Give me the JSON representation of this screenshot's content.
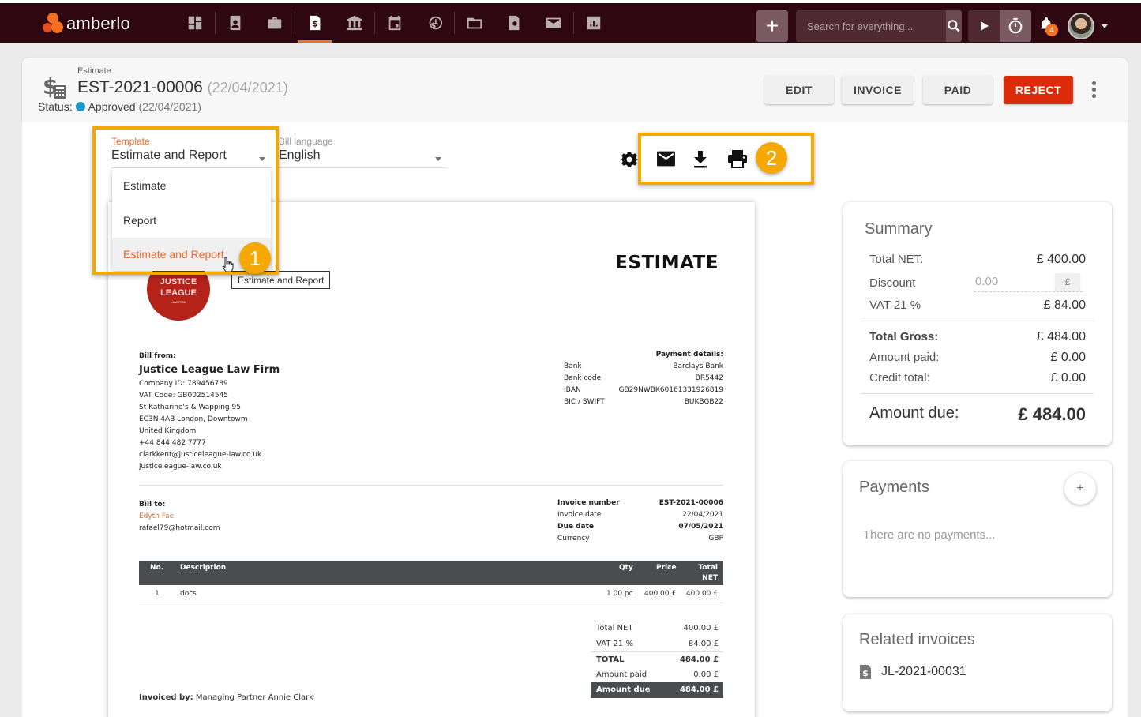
{
  "app": {
    "brand": "amberlo",
    "nav": [
      {
        "icon": "dashboard-icon",
        "label": "Dashboard"
      },
      {
        "icon": "contacts-icon",
        "label": "Contacts"
      },
      {
        "icon": "matters-icon",
        "label": "Matters"
      },
      {
        "icon": "invoices-icon",
        "label": "Invoices",
        "active": true
      },
      {
        "icon": "bank-icon",
        "label": "Banking"
      },
      {
        "icon": "calendar-icon",
        "label": "Calendar"
      },
      {
        "icon": "time-billing-icon",
        "label": "Time"
      },
      {
        "icon": "folder-icon",
        "label": "Documents"
      },
      {
        "icon": "certificate-icon",
        "label": "Templates"
      },
      {
        "icon": "mail-icon",
        "label": "Mail"
      },
      {
        "icon": "reports-icon",
        "label": "Reports"
      }
    ],
    "add_label": "+",
    "search_placeholder": "Search for everything...",
    "notification_count": "4",
    "accent_color": "#f37021",
    "topbar_color": "#2f0710"
  },
  "header": {
    "type_label": "Estimate",
    "number": "EST-2021-00006",
    "date": "(22/04/2021)",
    "status_label": "Status:",
    "status": "Approved",
    "status_date": "(22/04/2021)",
    "status_color": "#1a98c9",
    "buttons": {
      "edit": "EDIT",
      "invoice": "INVOICE",
      "paid": "PAID",
      "reject": "REJECT"
    }
  },
  "controls": {
    "template_label": "Template",
    "template_value": "Estimate and Report",
    "template_options": [
      "Estimate",
      "Report",
      "Estimate and Report"
    ],
    "language_label": "Bill language",
    "language_value": "English",
    "tooltip": "Estimate and Report",
    "markers": [
      "1",
      "2"
    ]
  },
  "document": {
    "title": "ESTIMATE",
    "logo_line1": "JUSTICE",
    "logo_line2": "LEAGUE",
    "logo_line3": "LAW FIRM",
    "bill_from_label": "Bill from:",
    "firm_name": "Justice League Law Firm",
    "firm_lines": [
      "Company ID: 789456789",
      "VAT Code: GB002514545",
      "St Katharine's & Wapping 95",
      "EC3N 4AB London, Downtowm",
      "United Kingdom",
      "+44 844 482 7777",
      "clarkkent@justiceleague-law.co.uk",
      "justiceleague-law.co.uk"
    ],
    "payment_details_label": "Payment details:",
    "payment_details": [
      {
        "label": "Bank",
        "value": "Barclays Bank"
      },
      {
        "label": "Bank code",
        "value": "BR5442"
      },
      {
        "label": "IBAN",
        "value": "GB29NWBK60161331926819"
      },
      {
        "label": "BIC / SWIFT",
        "value": "BUKBGB22"
      }
    ],
    "bill_to_label": "Bill to:",
    "client_name": "Edyth Fae",
    "client_email": "rafael79@hotmail.com",
    "meta": [
      {
        "label": "Invoice number",
        "value": "EST-2021-00006",
        "bold": true
      },
      {
        "label": "Invoice date",
        "value": "22/04/2021",
        "bold": false
      },
      {
        "label": "Due date",
        "value": "07/05/2021",
        "bold": true
      },
      {
        "label": "Currency",
        "value": "GBP",
        "bold": false
      }
    ],
    "items_header": {
      "no": "No.",
      "description": "Description",
      "qty": "Qty",
      "price": "Price",
      "total_1": "Total",
      "total_2": "NET"
    },
    "items": [
      {
        "no": "1",
        "description": "docs",
        "qty": "1.00 pc",
        "price": "400.00 £",
        "total": "400.00 £"
      }
    ],
    "totals": [
      {
        "label": "Total NET",
        "value": "400.00 £"
      },
      {
        "label": "VAT 21 %",
        "value": "84.00 £"
      },
      {
        "label": "TOTAL",
        "value": "484.00 £"
      },
      {
        "label": "Amount paid",
        "value": "0.00 £"
      },
      {
        "label": "Amount due",
        "value": "484.00 £"
      }
    ],
    "invoiced_by_label": "Invoiced by:",
    "invoiced_by": "Managing Partner Annie Clark"
  },
  "summary": {
    "title": "Summary",
    "total_net_label": "Total NET:",
    "total_net": "£ 400.00",
    "discount_label": "Discount",
    "discount_value": "0.00",
    "discount_currency": "£",
    "vat_label": "VAT 21 %",
    "vat": "£ 84.00",
    "total_gross_label": "Total Gross:",
    "total_gross": "£ 484.00",
    "amount_paid_label": "Amount paid:",
    "amount_paid": "£ 0.00",
    "credit_total_label": "Credit total:",
    "credit_total": "£ 0.00",
    "amount_due_label": "Amount due:",
    "amount_due": "£ 484.00"
  },
  "payments": {
    "title": "Payments",
    "add_label": "+",
    "empty_text": "There are no payments..."
  },
  "related": {
    "title": "Related invoices",
    "items": [
      "JL-2021-00031"
    ]
  }
}
